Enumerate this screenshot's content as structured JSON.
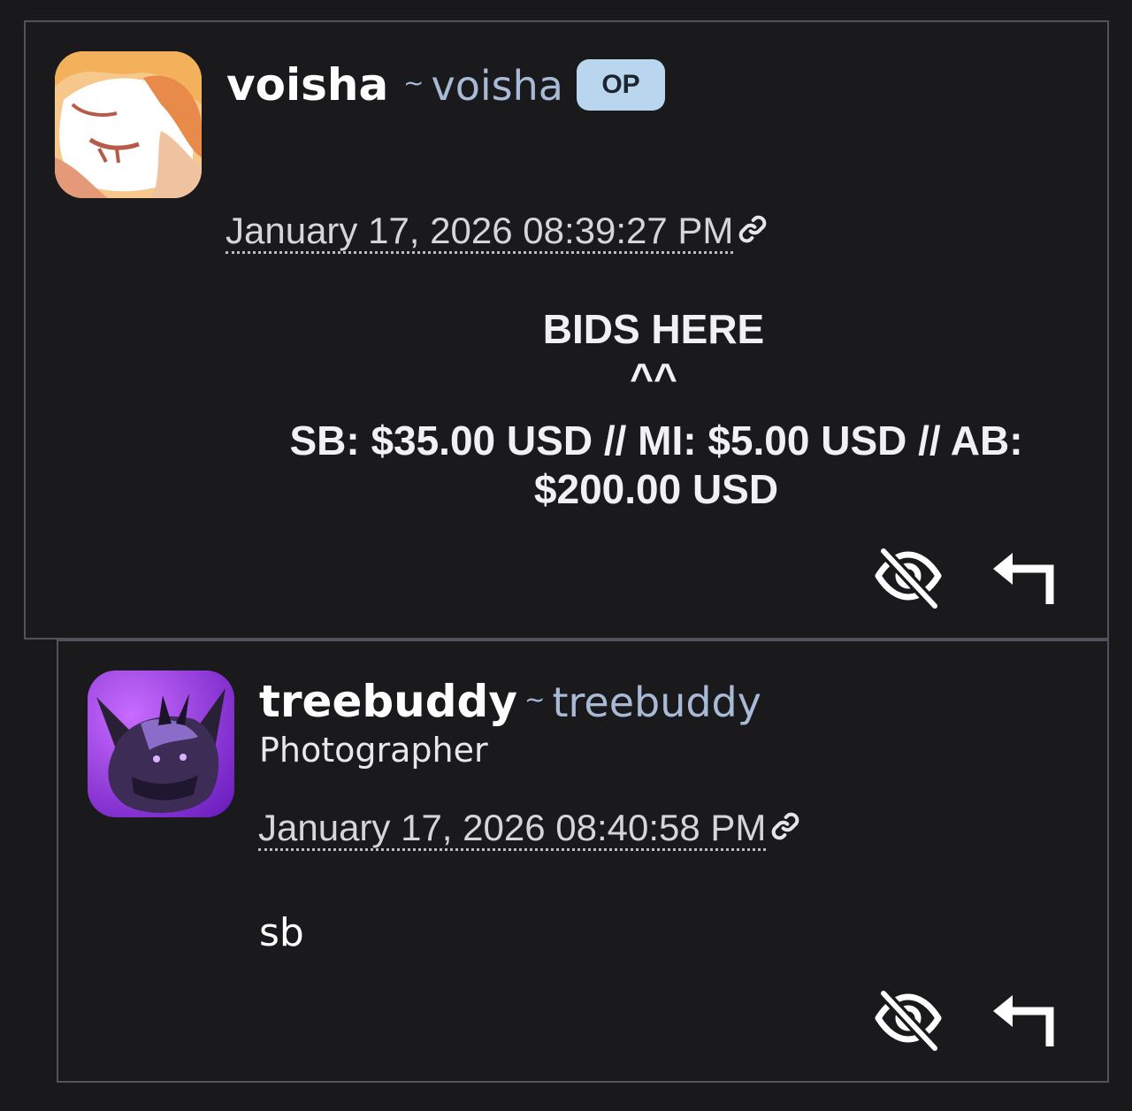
{
  "comments": [
    {
      "username": "voisha",
      "handle_prefix": "~",
      "handle": "voisha",
      "badge": "OP",
      "timestamp": "January 17, 2026 08:39:27 PM",
      "body_title": "BIDS HERE ^^",
      "body_text": "SB: $35.00 USD // MI: $5.00 USD // AB: $200.00 USD",
      "icons": {
        "permalink": "link-icon",
        "hide": "eye-slash-icon",
        "reply": "reply-arrow-icon"
      }
    },
    {
      "username": "treebuddy",
      "handle_prefix": "~",
      "handle": "treebuddy",
      "title": "Photographer",
      "timestamp": "January 17, 2026 08:40:58 PM",
      "body_text": "sb",
      "icons": {
        "permalink": "link-icon",
        "hide": "eye-slash-icon",
        "reply": "reply-arrow-icon"
      }
    }
  ],
  "colors": {
    "background": "#19191b",
    "border": "#52535a",
    "handle": "#a9bad6",
    "badge_bg": "#bad6ee",
    "badge_text": "#1c2430"
  }
}
